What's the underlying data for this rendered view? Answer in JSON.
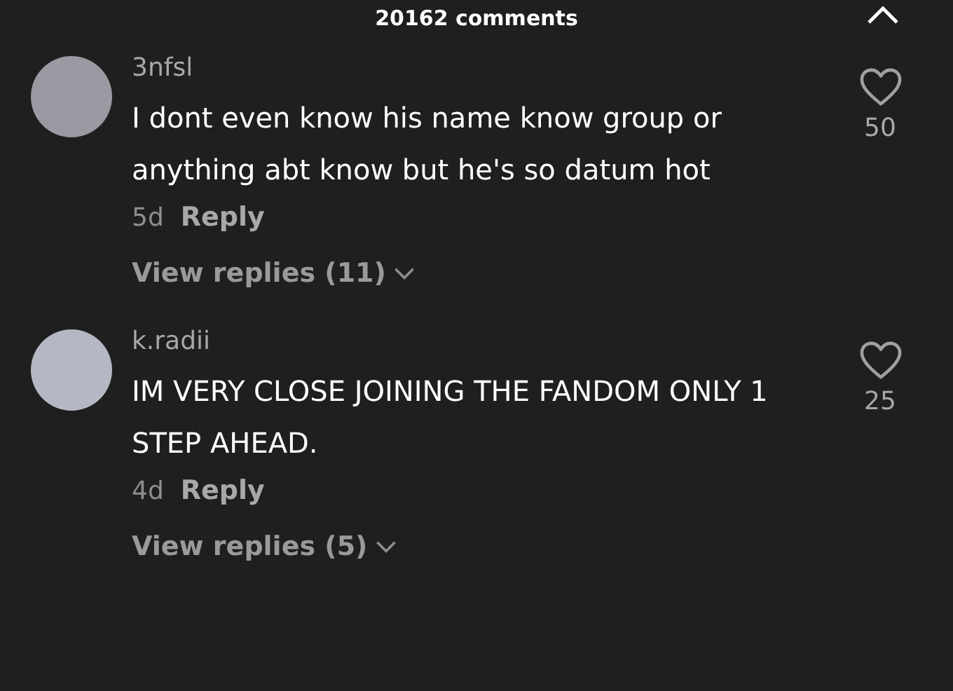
{
  "header": {
    "title": "20162 comments"
  },
  "comments": [
    {
      "username": "3nfsl",
      "text": "I dont even know his name know group or anything abt know but he's so datum hot",
      "age": "5d",
      "reply": "Reply",
      "view_replies": "View replies (11)",
      "likes": "50"
    },
    {
      "username": "k.radii",
      "text": "IM VERY CLOSE JOINING THE FANDOM ONLY 1 STEP AHEAD.",
      "age": "4d",
      "reply": "Reply",
      "view_replies": "View replies (5)",
      "likes": "25"
    }
  ]
}
